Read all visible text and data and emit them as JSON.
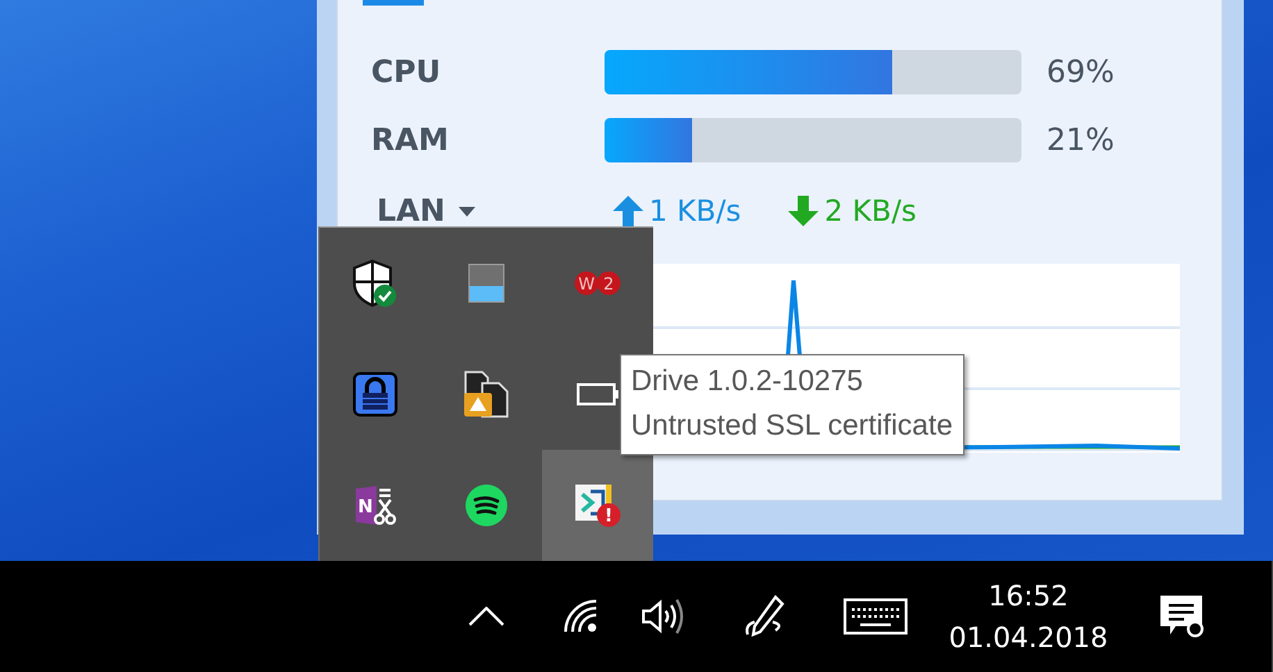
{
  "widget": {
    "meters": [
      {
        "label": "CPU",
        "level": 0.69,
        "reading": "69%"
      },
      {
        "label": "RAM",
        "level": 0.21,
        "reading": "21%"
      }
    ],
    "network": {
      "label": "LAN",
      "upload": "1 KB/s",
      "download": "2 KB/s"
    }
  },
  "tray_flyout": {
    "icons": [
      {
        "kind": "shield",
        "hovered": false
      },
      {
        "kind": "display",
        "hovered": false
      },
      {
        "kind": "badges",
        "glyphs": [
          "W",
          "2"
        ],
        "hovered": false
      },
      {
        "kind": "lock",
        "hovered": false
      },
      {
        "kind": "files",
        "hovered": false
      },
      {
        "kind": "battery",
        "hovered": false
      },
      {
        "kind": "notes",
        "glyphs": [
          "N"
        ],
        "hovered": false
      },
      {
        "kind": "music",
        "hovered": false
      },
      {
        "kind": "sync-warning",
        "glyphs": [
          "!"
        ],
        "hovered": true
      }
    ]
  },
  "tooltip": {
    "lines": [
      "Drive 1.0.2-10275",
      "Untrusted SSL certificate"
    ]
  },
  "taskbar": {
    "time": "16:52",
    "date": "01.04.2018"
  }
}
